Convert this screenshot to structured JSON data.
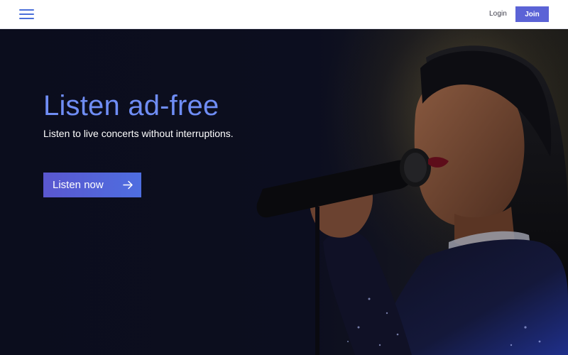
{
  "header": {
    "menu_icon": "hamburger-menu-icon",
    "login_label": "Login",
    "join_label": "Join"
  },
  "hero": {
    "title": "Listen ad-free",
    "subtitle": "Listen to live concerts without interruptions.",
    "cta_label": "Listen now",
    "cta_icon": "arrow-right-icon",
    "image_subject": "singer-with-microphone"
  },
  "colors": {
    "accent": "#5b63d6",
    "headline": "#6f8df5",
    "background": "#0b0d1d"
  }
}
